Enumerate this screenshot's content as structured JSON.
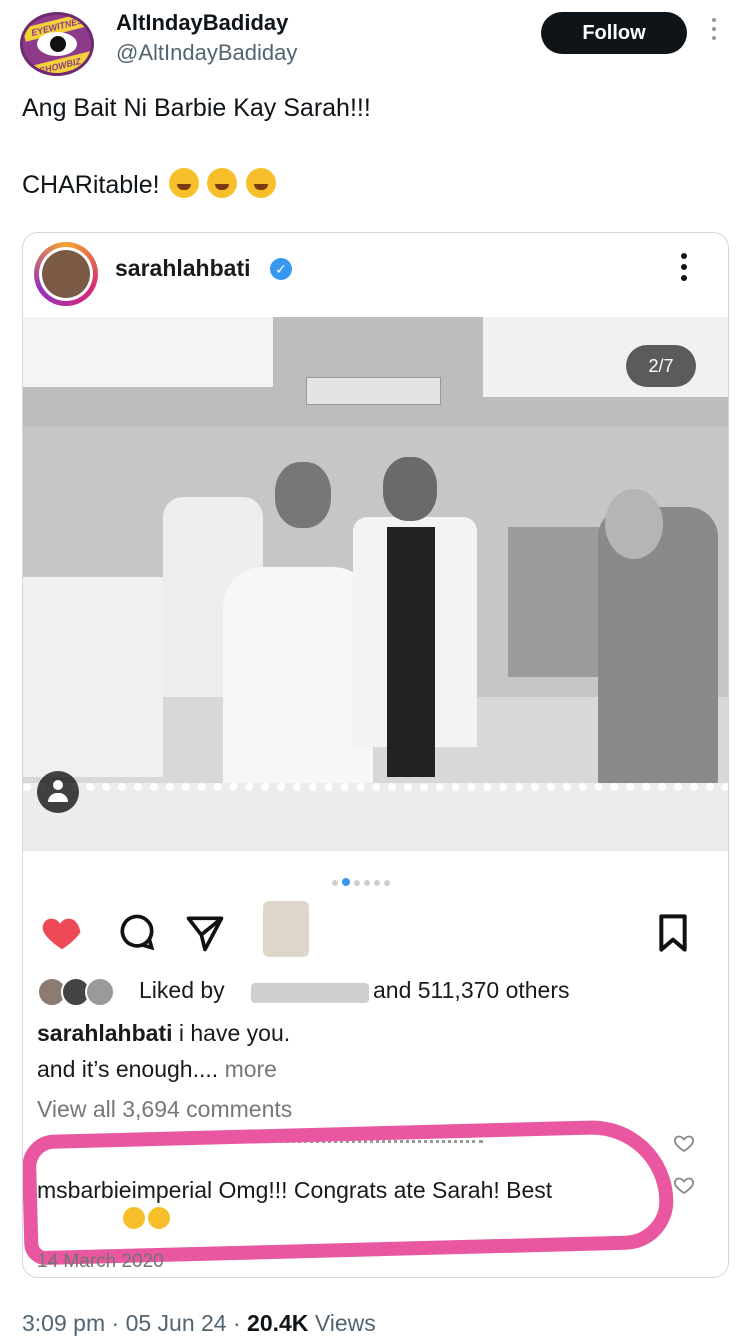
{
  "author": {
    "display_name": "AltIndayBadiday",
    "handle": "@AltIndayBadiday",
    "avatar_text_top": "EYEWITNESS",
    "avatar_text_bottom": "SHOWBIZ BALITA"
  },
  "follow_label": "Follow",
  "tweet": {
    "line1": "Ang Bait Ni Barbie Kay Sarah!!!",
    "line2": "CHARitable!"
  },
  "embed": {
    "username": "sarahlahbati",
    "slide_counter": "2/7",
    "liked_by_prefix": "Liked by",
    "liked_by_suffix": "and 511,370 others",
    "caption_user": "sarahlahbati",
    "caption_text": "i have you.",
    "caption_line2": "and it’s enough....",
    "caption_more": "more",
    "view_comments": "View all 3,694 comments",
    "comment_user": "msbarbieimperial",
    "comment_text": "Omg!!! Congrats ate Sarah! Best",
    "post_date": "14 March 2020"
  },
  "meta": {
    "time": "3:09 pm",
    "date": "05 Jun 24",
    "views_count": "20.4K",
    "views_label": "Views"
  },
  "colors": {
    "follow_bg": "#0f1419",
    "highlight": "#e8579f",
    "like_heart": "#ed4956",
    "verified": "#3897f0"
  }
}
